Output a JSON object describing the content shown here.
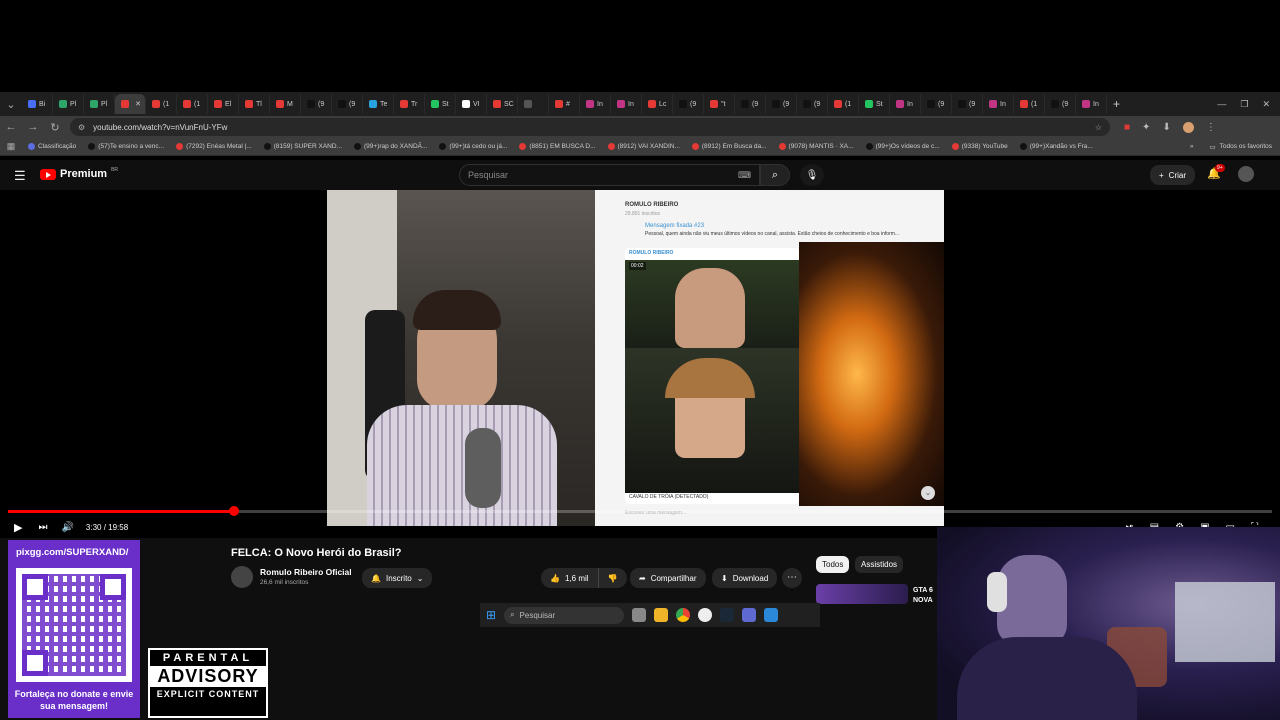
{
  "browser": {
    "tabs": [
      "Bi",
      "Pl",
      "Pl",
      "",
      "(1",
      "(1",
      "El",
      "Tl",
      "M",
      "(9",
      "(9",
      "Te",
      "Tr",
      "St",
      "VI",
      "SC",
      "",
      "#",
      "In",
      "In",
      "Lc",
      "(9",
      "\"t",
      "(9",
      "(9",
      "(9",
      "(1",
      "St",
      "In",
      "(9",
      "(9",
      "In",
      "(1",
      "(9",
      "In"
    ],
    "url": "youtube.com/watch?v=nVunFnU-YFw",
    "bookmarks": [
      "Classificação",
      "(57)Te ensino a venc...",
      "(7292) Enéas Metal |...",
      "(8159) SUPER XAND...",
      "(99+)rap do XANDÃ...",
      "(99+)tá cedo ou já...",
      "(8851) EM BUSCA D...",
      "(8912) VAI XANDIN...",
      "(8912) Em Busca da...",
      "(9078) MANTIS · XA...",
      "(99+)Os vídeos de c...",
      "(9338) YouTube",
      "(99+)Xandão vs Fra..."
    ],
    "bookmarks_folder": "Todos os favoritos"
  },
  "youtube": {
    "logo": "Premium",
    "logo_region": "BR",
    "search_placeholder": "Pesquisar",
    "create_label": "Criar",
    "notifications_badge": "9+"
  },
  "player": {
    "time": "3:30 / 19:58",
    "progress": 0.179,
    "embedded_chat": {
      "channel": "ROMULO RIBEIRO",
      "subscribers": "29.891 inscritos",
      "pinned_title": "Mensagem fixada #23",
      "pinned_text": "Pessoal, quem ainda não viu meus últimos vídeos no canal, assista. Estão cheios de conhecimento e boa inform...",
      "post_author": "ROMULO RIBEIRO",
      "post_time": "00:02",
      "caption": "CAVALO DE TRÓIA (DETECTADO)",
      "compose_placeholder": "Escrever uma mensagem..."
    }
  },
  "video_info": {
    "title": "FELCA: O Novo Herói do Brasil?",
    "channel": "Romulo Ribeiro Oficial",
    "subscribers": "26,6 mil inscritos",
    "subscribed_label": "Inscrito",
    "likes": "1,6 mil",
    "share_label": "Compartilhar",
    "download_label": "Download",
    "chip_all": "Todos",
    "chip_watched": "Assistidos",
    "rec_title": "GTA 6 NOVA"
  },
  "taskbar": {
    "search_placeholder": "Pesquisar"
  },
  "overlay": {
    "pix_url": "pixgg.com/SUPERXAND/",
    "donate_text": "Fortaleça no donate e envie sua mensagem!",
    "advisory_top": "PARENTAL",
    "advisory_mid": "ADVISORY",
    "advisory_bottom": "EXPLICIT CONTENT"
  }
}
